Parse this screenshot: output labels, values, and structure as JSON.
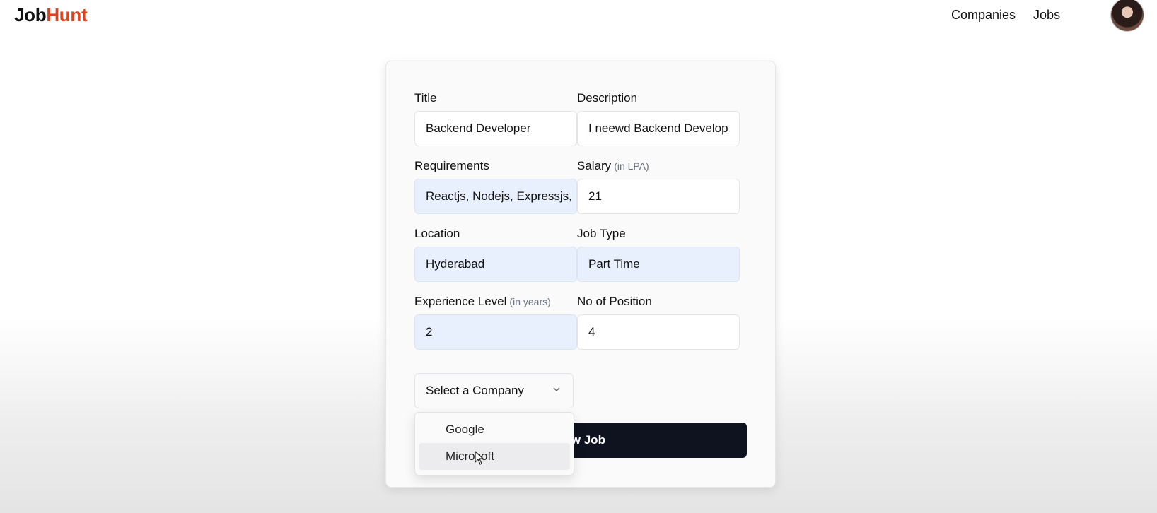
{
  "brand": {
    "part_a": "Job",
    "part_b": "Hunt",
    "accent_color": "#e0401b"
  },
  "nav": {
    "links": [
      "Companies",
      "Jobs"
    ],
    "avatar_icon": "user-avatar"
  },
  "form": {
    "title": {
      "label": "Title",
      "value": "Backend Developer"
    },
    "description": {
      "label": "Description",
      "value": "I neewd Backend Develop"
    },
    "requirements": {
      "label": "Requirements",
      "value": "Reactjs, Nodejs, Expressjs,"
    },
    "salary": {
      "label": "Salary",
      "hint": "(in LPA)",
      "value": "21"
    },
    "location": {
      "label": "Location",
      "value": "Hyderabad"
    },
    "job_type": {
      "label": "Job Type",
      "value": "Part Time"
    },
    "experience": {
      "label": "Experience Level",
      "hint": "(in years)",
      "value": "2"
    },
    "positions": {
      "label": "No of Position",
      "value": "4"
    },
    "company_select": {
      "placeholder": "Select a Company",
      "icon": "chevron-down-icon"
    },
    "submit_label": "New Job",
    "company_options": [
      "Google",
      "Microsoft"
    ],
    "highlighted_option": "Microsoft"
  }
}
